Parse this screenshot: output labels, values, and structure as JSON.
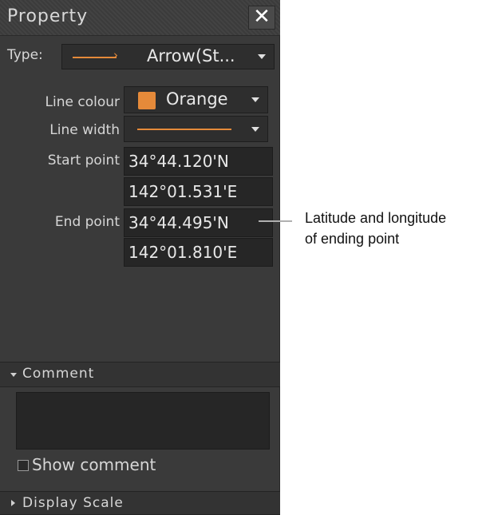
{
  "window": {
    "title": "Property"
  },
  "type": {
    "label": "Type:",
    "value": "Arrow(St..."
  },
  "line_colour": {
    "label": "Line colour",
    "value": "Orange",
    "swatch_color": "#e58a3a"
  },
  "line_width": {
    "label": "Line width"
  },
  "start_point": {
    "label": "Start point",
    "lat": "34°44.120'N",
    "lon": "142°01.531'E"
  },
  "end_point": {
    "label": "End point",
    "lat": "34°44.495'N",
    "lon": "142°01.810'E"
  },
  "comment": {
    "header": "Comment",
    "text": ""
  },
  "show_comment": {
    "label": "Show comment",
    "checked": false
  },
  "display_scale": {
    "header": "Display Scale"
  },
  "annotation": {
    "line1": "Latitude and longitude",
    "line2": "of ending point"
  },
  "icons": {
    "close": "close-icon",
    "dropdown": "chevron-down-icon"
  }
}
